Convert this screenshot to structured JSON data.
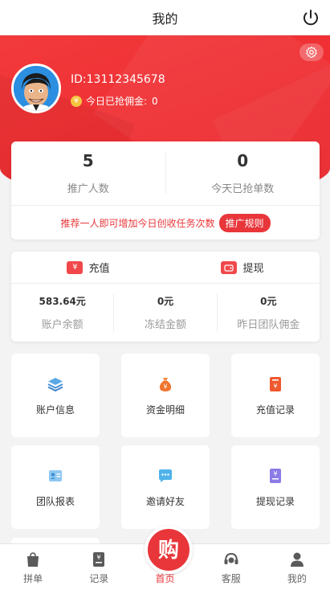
{
  "header": {
    "title": "我的"
  },
  "profile": {
    "id_text": "ID:13112345678",
    "today_commission_label": "今日已抢佣金:",
    "today_commission_value": "0"
  },
  "stats": {
    "items": [
      {
        "value": "5",
        "label": "推广人数"
      },
      {
        "value": "0",
        "label": "今天已抢单数"
      }
    ],
    "promo_text": "推荐一人即可增加今日创收任务次数",
    "rule_button": "推广规则"
  },
  "balance": {
    "actions": [
      {
        "label": "充值",
        "icon": "yen-card-icon"
      },
      {
        "label": "提现",
        "icon": "wallet-icon"
      }
    ],
    "items": [
      {
        "amount": "583.64元",
        "label": "账户余额"
      },
      {
        "amount": "0元",
        "label": "冻结金额"
      },
      {
        "amount": "0元",
        "label": "昨日团队佣金"
      }
    ]
  },
  "menu": [
    {
      "label": "账户信息",
      "icon": "layers-icon"
    },
    {
      "label": "资金明细",
      "icon": "money-bag-icon"
    },
    {
      "label": "充值记录",
      "icon": "recharge-record-icon"
    },
    {
      "label": "团队报表",
      "icon": "team-report-icon"
    },
    {
      "label": "邀请好友",
      "icon": "chat-invite-icon"
    },
    {
      "label": "提现记录",
      "icon": "withdraw-record-icon"
    }
  ],
  "bottom_nav": [
    {
      "label": "拼单",
      "icon": "bag-icon"
    },
    {
      "label": "记录",
      "icon": "record-icon"
    },
    {
      "label": "首页",
      "icon": "buy-icon",
      "active": true
    },
    {
      "label": "客服",
      "icon": "headset-icon"
    },
    {
      "label": "我的",
      "icon": "user-icon"
    }
  ],
  "colors": {
    "accent": "#e8363a",
    "hero": "#ef3236"
  }
}
